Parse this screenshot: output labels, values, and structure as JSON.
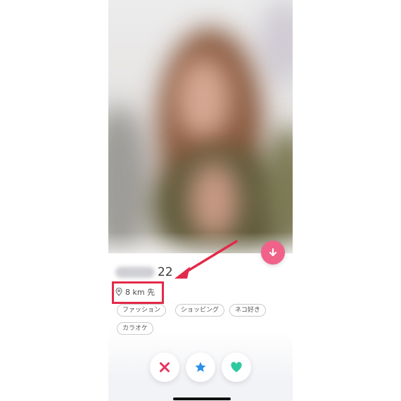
{
  "profile": {
    "age": "22",
    "distance": "8 km 先",
    "tags": [
      "ファッション",
      "ショッピング",
      "ネコ好き",
      "カラオケ"
    ]
  },
  "icons": {
    "info": "chevron-down-icon",
    "location": "location-pin-icon",
    "dislike": "close-icon",
    "super_like": "star-icon",
    "like": "heart-icon"
  },
  "colors": {
    "annotation": "#e32a4a",
    "info_button": "#f0628a",
    "dislike": "#e8345d",
    "super_like": "#2b8fe8",
    "like": "#2fc9a0"
  }
}
